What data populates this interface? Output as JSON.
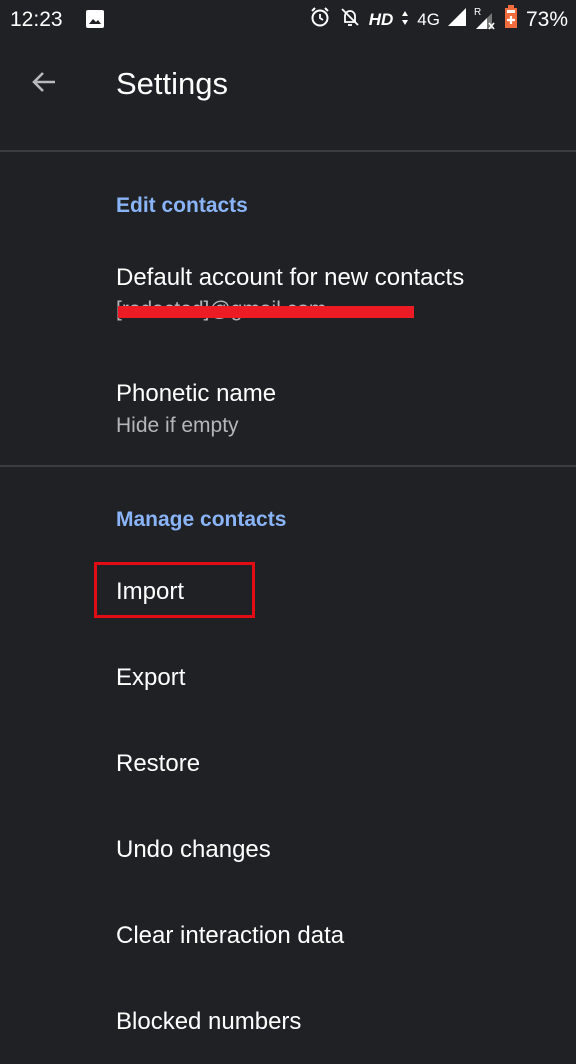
{
  "status_bar": {
    "time": "12:23",
    "icons": [
      "image-notification-icon",
      "alarm-icon",
      "notifications-off-icon",
      "signal-icon",
      "roaming-signal-icon",
      "battery-charging-icon"
    ],
    "hd_label": "HD",
    "network_label": "4G",
    "roaming_label": "R",
    "battery_percent": "73%"
  },
  "app_bar": {
    "back_icon": "arrow-back-icon",
    "title": "Settings"
  },
  "sections": [
    {
      "header": "Edit contacts",
      "items": [
        {
          "title": "Default account for new contacts",
          "summary": "[redacted]@gmail.com",
          "summary_redacted": true
        },
        {
          "title": "Phonetic name",
          "summary": "Hide if empty"
        }
      ]
    },
    {
      "header": "Manage contacts",
      "items": [
        {
          "title": "Import",
          "highlighted": true
        },
        {
          "title": "Export"
        },
        {
          "title": "Restore"
        },
        {
          "title": "Undo changes"
        },
        {
          "title": "Clear interaction data"
        },
        {
          "title": "Blocked numbers"
        }
      ]
    }
  ],
  "colors": {
    "background": "#202124",
    "accent": "#8ab4f8",
    "redaction": "#ed1c24",
    "highlight_box": "#e20d14"
  }
}
